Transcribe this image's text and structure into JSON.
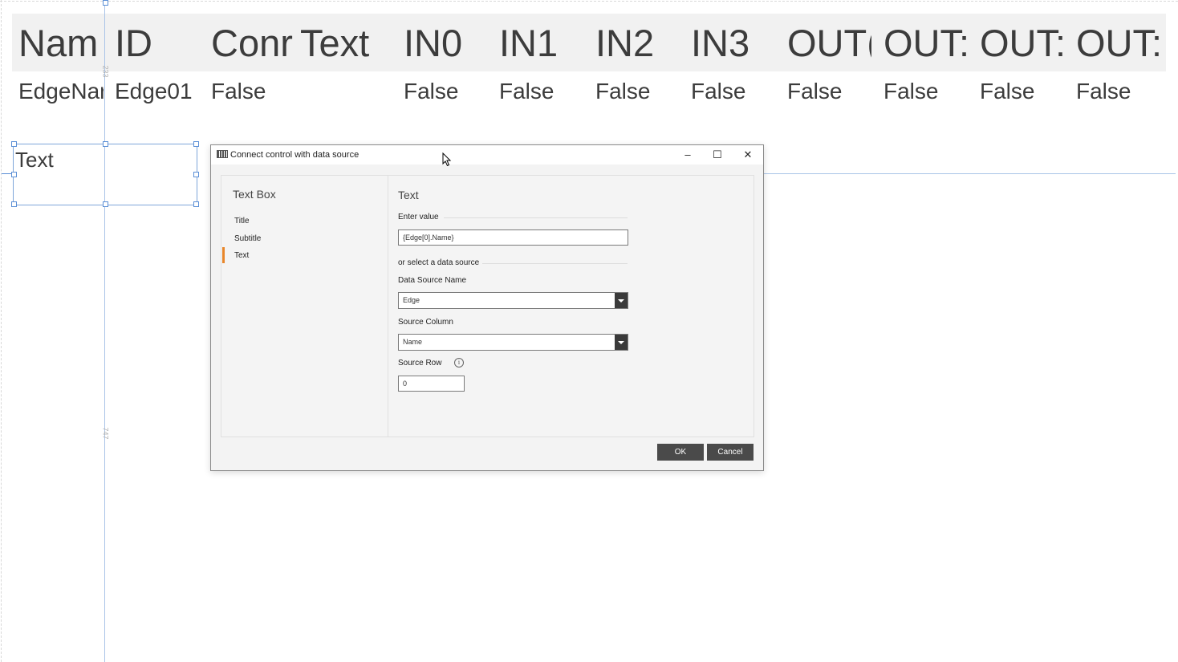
{
  "grid": {
    "headers": [
      "Nam",
      "ID",
      "Conr",
      "Text",
      "IN0",
      "IN1",
      "IN2",
      "IN3",
      "OUT(",
      "OUT:",
      "OUT:",
      "OUT:"
    ],
    "values": [
      "EdgeNar",
      "Edge01",
      "False",
      "",
      "False",
      "False",
      "False",
      "False",
      "False",
      "False",
      "False",
      "False"
    ]
  },
  "guides": {
    "top_value": "233",
    "bottom_value": "747"
  },
  "selected_box": {
    "text": "Text"
  },
  "dialog": {
    "title": "Connect control with data source",
    "minimize": "–",
    "maximize": "☐",
    "close": "✕",
    "nav": {
      "title": "Text Box",
      "items": [
        "Title",
        "Subtitle",
        "Text"
      ],
      "active": "Text"
    },
    "panel": {
      "title": "Text",
      "enter_value_label": "Enter value",
      "value": "{Edge[0].Name}",
      "or_select_label": "or select a data source",
      "data_source_label": "Data Source Name",
      "data_source_value": "Edge",
      "source_column_label": "Source Column",
      "source_column_value": "Name",
      "source_row_label": "Source Row",
      "source_row_value": "0",
      "info_glyph": "i"
    },
    "ok_label": "OK",
    "cancel_label": "Cancel"
  }
}
